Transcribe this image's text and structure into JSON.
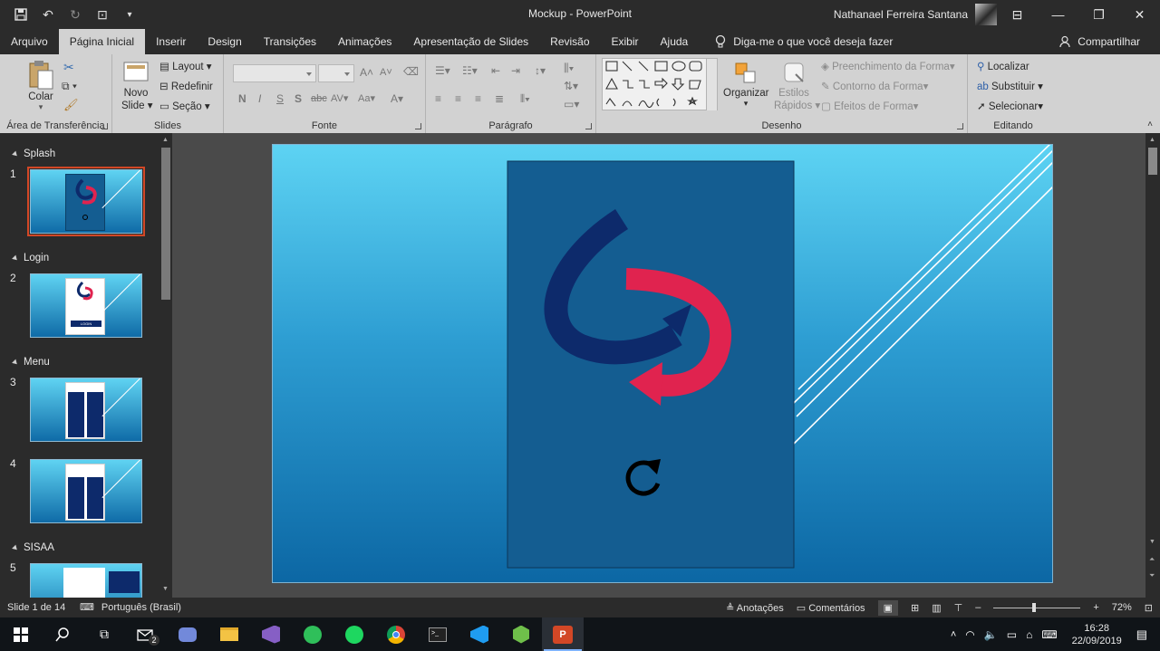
{
  "app": {
    "title": "Mockup  -  PowerPoint",
    "user_name": "Nathanael Ferreira Santana"
  },
  "tabs": [
    {
      "label": "Arquivo",
      "active": false
    },
    {
      "label": "Página Inicial",
      "active": true
    },
    {
      "label": "Inserir",
      "active": false
    },
    {
      "label": "Design",
      "active": false
    },
    {
      "label": "Transições",
      "active": false
    },
    {
      "label": "Animações",
      "active": false
    },
    {
      "label": "Apresentação de Slides",
      "active": false
    },
    {
      "label": "Revisão",
      "active": false
    },
    {
      "label": "Exibir",
      "active": false
    },
    {
      "label": "Ajuda",
      "active": false
    }
  ],
  "tell_me": "Diga-me o que você deseja fazer",
  "share": "Compartilhar",
  "ribbon": {
    "clipboard": {
      "label": "Área de Transferência",
      "paste": "Colar"
    },
    "slides": {
      "label": "Slides",
      "new_slide_1": "Novo",
      "new_slide_2": "Slide",
      "layout": "Layout",
      "reset": "Redefinir",
      "section": "Seção"
    },
    "font": {
      "label": "Fonte",
      "bold": "N",
      "italic": "I",
      "underline": "S",
      "shadow": "S",
      "strike": "abc",
      "spacing": "AV",
      "case": "Aa",
      "grow": "A",
      "shrink": "A"
    },
    "paragraph": {
      "label": "Parágrafo"
    },
    "drawing": {
      "label": "Desenho",
      "arrange": "Organizar",
      "quick_styles_1": "Estilos",
      "quick_styles_2": "Rápidos",
      "fill": "Preenchimento da Forma",
      "outline": "Contorno da Forma",
      "effects": "Efeitos de Forma"
    },
    "editing": {
      "label": "Editando",
      "find": "Localizar",
      "replace": "Substituir",
      "select": "Selecionar"
    }
  },
  "sections": [
    {
      "name": "Splash"
    },
    {
      "name": "Login"
    },
    {
      "name": "Menu"
    },
    {
      "name": "SISAA"
    }
  ],
  "slides": [
    {
      "number": "1",
      "login_label": ""
    },
    {
      "number": "2",
      "login_label": "LOGIN"
    },
    {
      "number": "3",
      "login_label": ""
    },
    {
      "number": "4",
      "login_label": ""
    },
    {
      "number": "5",
      "login_label": ""
    }
  ],
  "status": {
    "slide_count": "Slide 1 de 14",
    "language": "Português (Brasil)",
    "notes": "Anotações",
    "comments": "Comentários",
    "zoom": "72%",
    "zoom_fraction": 0.46
  },
  "taskbar": {
    "mail_badge": "2",
    "time": "16:28",
    "date": "22/09/2019"
  },
  "colors": {
    "accent": "#d24726",
    "card": "#145d91",
    "arrow_dark": "#0d2a6b",
    "arrow_red": "#e0234f"
  }
}
